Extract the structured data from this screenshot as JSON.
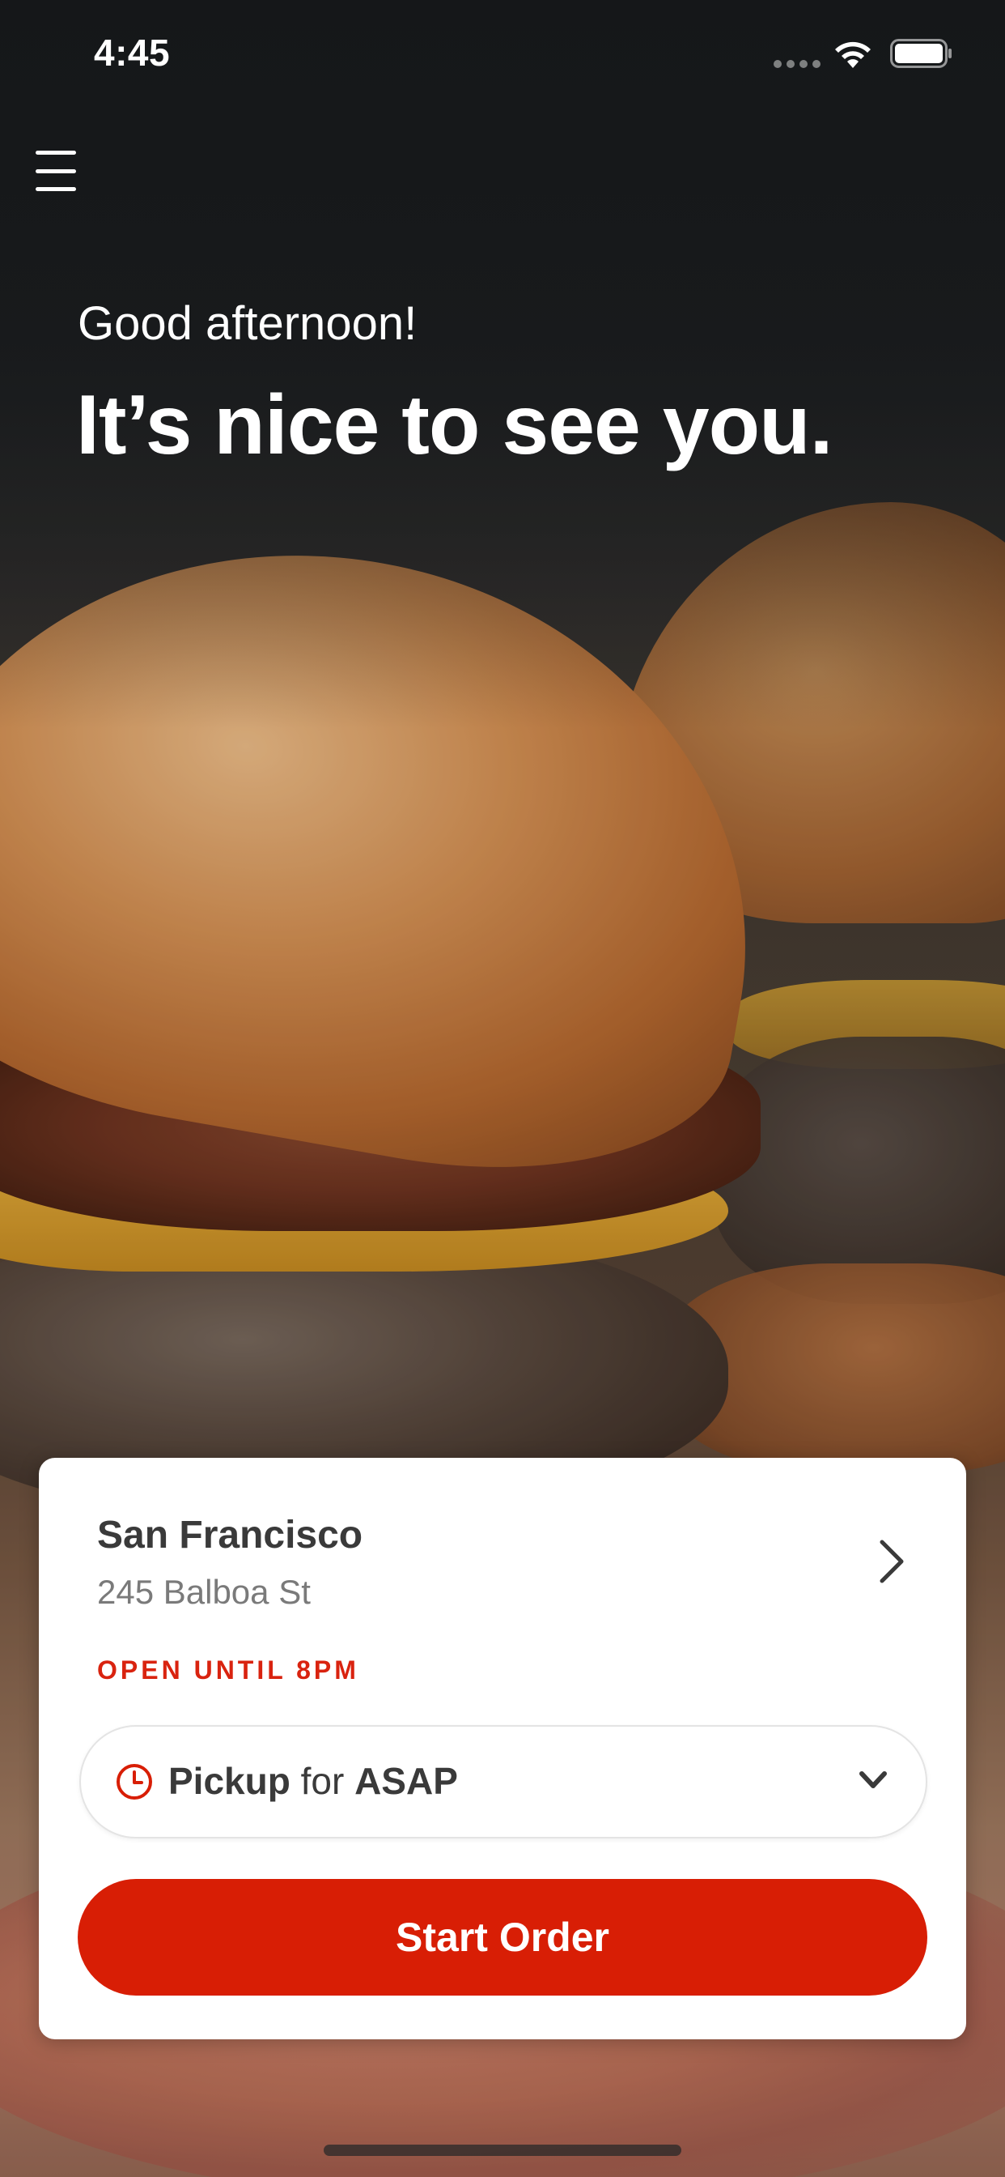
{
  "status_bar": {
    "time": "4:45",
    "wifi_icon": "wifi-icon",
    "battery_icon": "battery-icon"
  },
  "menu": {
    "icon": "hamburger-menu-icon"
  },
  "hero": {
    "greeting": "Good afternoon!",
    "headline": "It’s nice to see you.",
    "image": "burger-photo"
  },
  "location": {
    "name": "San Francisco",
    "address": "245 Balboa St",
    "hours": "OPEN UNTIL 8PM",
    "chevron_icon": "chevron-right-icon"
  },
  "order_mode": {
    "icon": "clock-icon",
    "mode": "Pickup",
    "connector": "for",
    "time": "ASAP",
    "dropdown_icon": "chevron-down-icon"
  },
  "actions": {
    "start_order": "Start Order"
  },
  "colors": {
    "accent": "#d81e05",
    "hours_text": "#d9230f",
    "card_bg": "#ffffff",
    "primary_text": "#3a3a3a",
    "secondary_text": "#7a7a7a"
  }
}
